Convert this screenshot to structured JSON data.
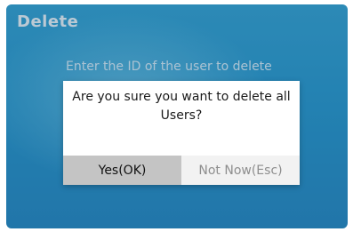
{
  "screen": {
    "title": "Delete",
    "prompt": "Enter the ID of the user to delete"
  },
  "dialog": {
    "message": "Are you sure you want to delete all Users?",
    "confirm_label": "Yes(OK)",
    "cancel_label": "Not Now(Esc)"
  },
  "colors": {
    "background": "#2d9cd0",
    "confirm_button": "#c4c4c4",
    "cancel_button": "#f2f2f2"
  }
}
